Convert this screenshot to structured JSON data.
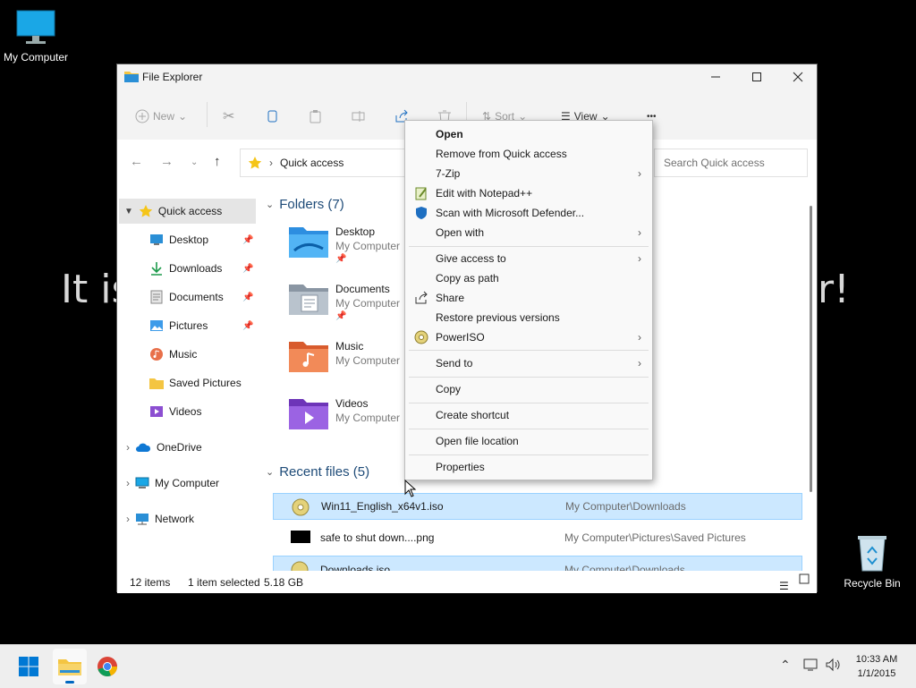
{
  "desktop": {
    "background_text": "It is",
    "background_text_end": "r!",
    "icons": {
      "my_computer": "My Computer",
      "recycle_bin": "Recycle Bin"
    }
  },
  "window": {
    "title": "File Explorer",
    "commands": {
      "new": "New",
      "sort": "Sort",
      "view": "View",
      "more": "•••"
    },
    "address": {
      "breadcrumb": "Quick access"
    },
    "search_placeholder": "Search Quick access",
    "sidebar": [
      {
        "label": "Quick access",
        "icon": "star-icon"
      },
      {
        "label": "Desktop",
        "icon": "desktop-icon"
      },
      {
        "label": "Downloads",
        "icon": "download-icon"
      },
      {
        "label": "Documents",
        "icon": "documents-icon"
      },
      {
        "label": "Pictures",
        "icon": "pictures-icon"
      },
      {
        "label": "Music",
        "icon": "music-icon"
      },
      {
        "label": "Saved Pictures",
        "icon": "folder-icon"
      },
      {
        "label": "Videos",
        "icon": "videos-icon"
      },
      {
        "label": "OneDrive",
        "icon": "cloud-icon"
      },
      {
        "label": "My Computer",
        "icon": "computer-icon"
      },
      {
        "label": "Network",
        "icon": "network-icon"
      }
    ],
    "folders_header": "Folders (7)",
    "folders": [
      {
        "name": "Desktop",
        "location": "My Computer"
      },
      {
        "name": "Documents",
        "location": "My Computer"
      },
      {
        "name": "Music",
        "location": "My Computer"
      },
      {
        "name": "Videos",
        "location": "My Computer"
      }
    ],
    "recent_header": "Recent files (5)",
    "recent_files": [
      {
        "name": "Win11_English_x64v1.iso",
        "location": "My Computer\\Downloads"
      },
      {
        "name": "safe to shut down....png",
        "location": "My Computer\\Pictures\\Saved Pictures"
      },
      {
        "name": "Downloads.iso",
        "location": "My Computer\\Downloads"
      }
    ],
    "status": {
      "items": "12 items",
      "selected": "1 item selected",
      "size": "5.18 GB"
    }
  },
  "context_menu": {
    "items": [
      {
        "label": "Open",
        "bold": true
      },
      {
        "label": "Remove from Quick access"
      },
      {
        "label": "7-Zip",
        "submenu": true
      },
      {
        "label": "Edit with Notepad++",
        "icon": "notepadpp-icon"
      },
      {
        "label": "Scan with Microsoft Defender...",
        "icon": "defender-shield-icon"
      },
      {
        "label": "Open with",
        "submenu": true
      },
      {
        "label": "Give access to",
        "submenu": true
      },
      {
        "label": "Copy as path"
      },
      {
        "label": "Share",
        "icon": "share-icon"
      },
      {
        "label": "Restore previous versions"
      },
      {
        "label": "PowerISO",
        "icon": "poweriso-icon",
        "submenu": true
      },
      {
        "label": "Send to",
        "submenu": true
      },
      {
        "label": "Copy"
      },
      {
        "label": "Create shortcut"
      },
      {
        "label": "Open file location"
      },
      {
        "label": "Properties"
      }
    ]
  },
  "taskbar": {
    "time": "10:33 AM",
    "date": "1/1/2015"
  },
  "colors": {
    "accent": "#0067c0",
    "selection": "#cce8ff",
    "folder_yellow": "#f4c542"
  }
}
